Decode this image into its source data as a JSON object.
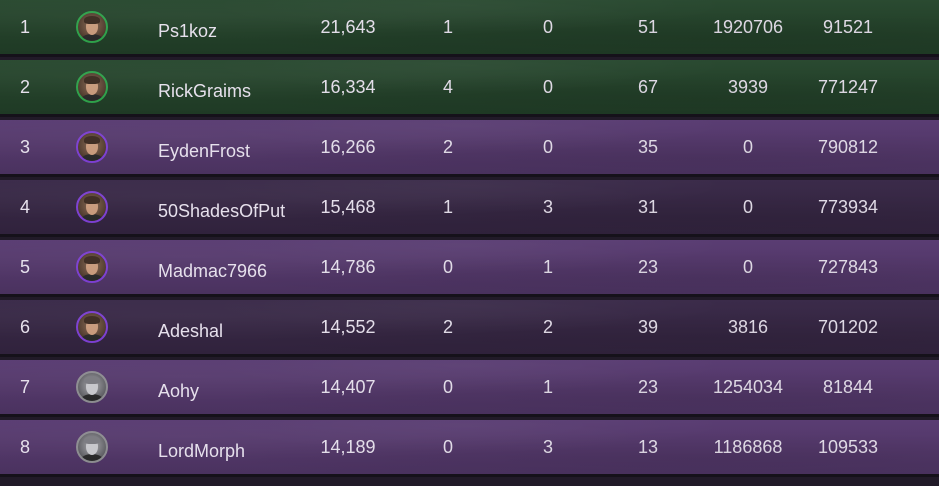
{
  "leaderboard": {
    "rows": [
      {
        "rank": "1",
        "name": "Ps1koz",
        "score": "21,643",
        "col_a": "1",
        "col_b": "0",
        "col_c": "51",
        "col_d": "1920706",
        "col_e": "91521",
        "row_style": "green",
        "avatar_icon": "player-portrait-icon",
        "avatar_ring": "#2ea14a"
      },
      {
        "rank": "2",
        "name": "RickGraims",
        "score": "16,334",
        "col_a": "4",
        "col_b": "0",
        "col_c": "67",
        "col_d": "3939",
        "col_e": "771247",
        "row_style": "green",
        "avatar_icon": "player-portrait-icon",
        "avatar_ring": "#2ea14a"
      },
      {
        "rank": "3",
        "name": "EydenFrost",
        "score": "16,266",
        "col_a": "2",
        "col_b": "0",
        "col_c": "35",
        "col_d": "0",
        "col_e": "790812",
        "row_style": "purple",
        "avatar_icon": "player-portrait-icon",
        "avatar_ring": "#7c3fd1"
      },
      {
        "rank": "4",
        "name": "50ShadesOfPut",
        "score": "15,468",
        "col_a": "1",
        "col_b": "3",
        "col_c": "31",
        "col_d": "0",
        "col_e": "773934",
        "row_style": "dark",
        "avatar_icon": "player-portrait-icon",
        "avatar_ring": "#7c3fd1"
      },
      {
        "rank": "5",
        "name": "Madmac7966",
        "score": "14,786",
        "col_a": "0",
        "col_b": "1",
        "col_c": "23",
        "col_d": "0",
        "col_e": "727843",
        "row_style": "purple",
        "avatar_icon": "player-portrait-icon",
        "avatar_ring": "#7c3fd1"
      },
      {
        "rank": "6",
        "name": "Adeshal",
        "score": "14,552",
        "col_a": "2",
        "col_b": "2",
        "col_c": "39",
        "col_d": "3816",
        "col_e": "701202",
        "row_style": "dark",
        "avatar_icon": "player-portrait-icon",
        "avatar_ring": "#7c3fd1"
      },
      {
        "rank": "7",
        "name": "Aohy",
        "score": "14,407",
        "col_a": "0",
        "col_b": "1",
        "col_c": "23",
        "col_d": "1254034",
        "col_e": "81844",
        "row_style": "purple",
        "avatar_icon": "player-portrait-icon",
        "avatar_ring": "#8c8c90"
      },
      {
        "rank": "8",
        "name": "LordMorph",
        "score": "14,189",
        "col_a": "0",
        "col_b": "3",
        "col_c": "13",
        "col_d": "1186868",
        "col_e": "109533",
        "row_style": "purple",
        "avatar_icon": "player-portrait-icon",
        "avatar_ring": "#8c8c90"
      }
    ]
  },
  "colors": {
    "green_row": "#234029",
    "purple_row": "#523768",
    "dark_row": "#352642",
    "text": "#e6e0ec"
  }
}
